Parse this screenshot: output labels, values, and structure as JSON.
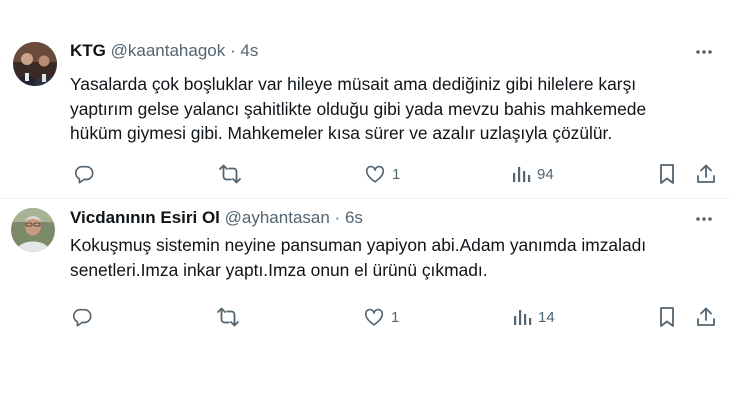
{
  "tweets": [
    {
      "name": "KTG",
      "handle": "@kaantahagok",
      "separator": "·",
      "time": "4s",
      "text_lines": [
        "Yasalarda çok boşluklar var hileye müsait ama dediğiniz gibi hilelere karşı",
        "yaptırım gelse yalancı şahitlikte olduğu gibi yada mevzu bahis mahkemede",
        "hüküm giymesi gibi. Mahkemeler kısa sürer ve azalır uzlaşıyla çözülür."
      ],
      "likes": "1",
      "views": "94"
    },
    {
      "name": "Vicdanının Esiri Ol",
      "handle": "@ayhantasan",
      "separator": "·",
      "time": "6s",
      "text_lines": [
        "Kokuşmuş sistemin neyine pansuman yapiyon abi.Adam yanımda imzaladı",
        "senetleri.Imza inkar yaptı.Imza onun el ürünü çıkmadı."
      ],
      "likes": "1",
      "views": "14"
    }
  ],
  "icons": {
    "more": "more-icon",
    "reply": "reply-icon",
    "retweet": "retweet-icon",
    "like": "like-icon",
    "views": "views-icon",
    "bookmark": "bookmark-icon",
    "share": "share-icon"
  },
  "colors": {
    "text": "#0f1419",
    "secondary": "#536471",
    "divider": "#eff3f4",
    "background": "#ffffff"
  }
}
